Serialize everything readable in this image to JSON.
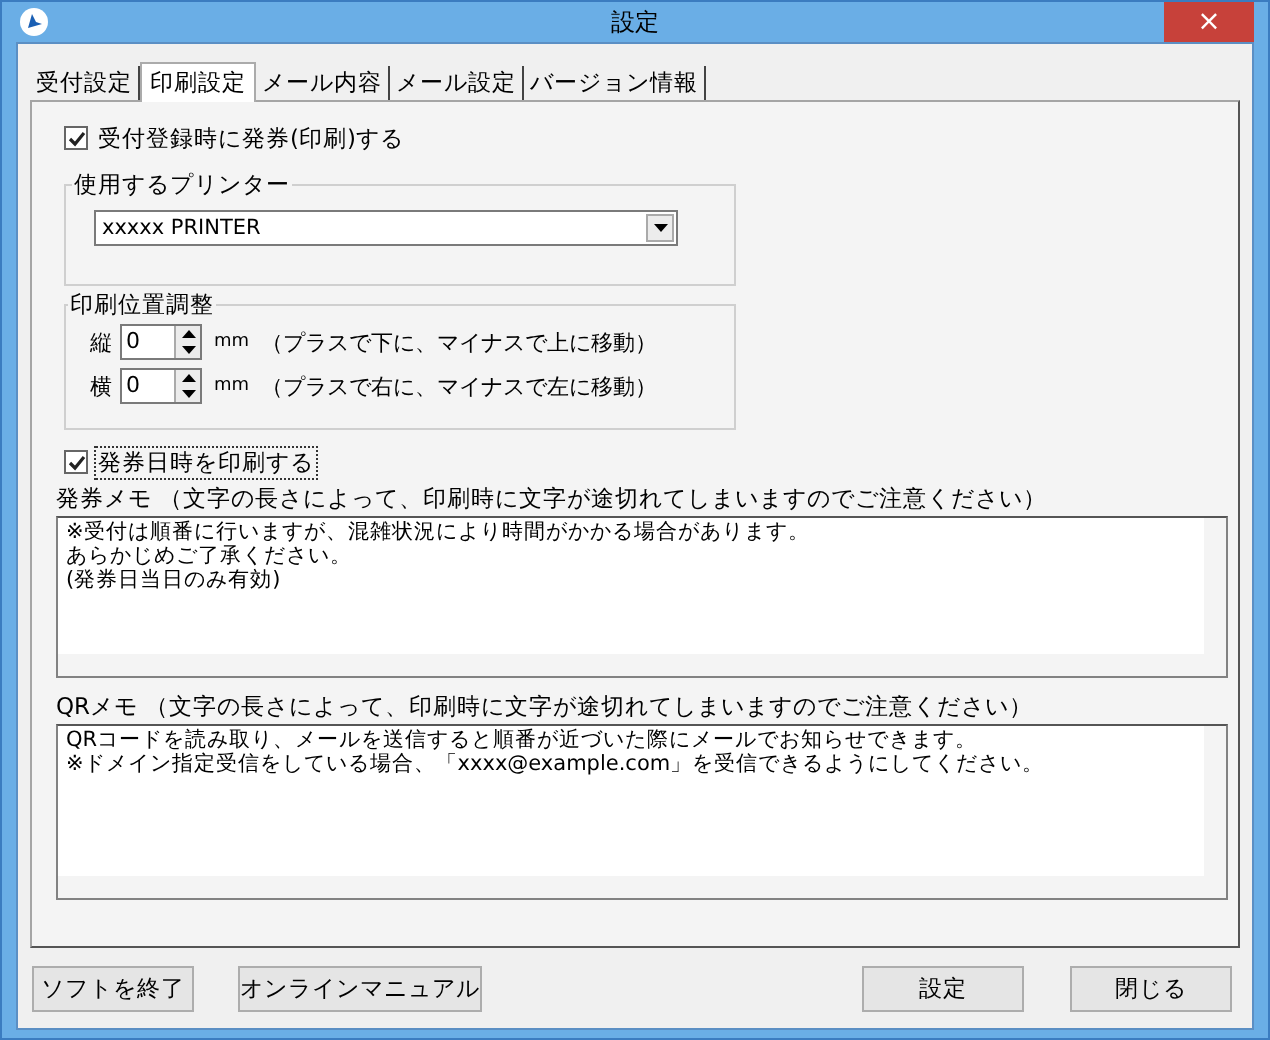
{
  "window": {
    "title": "設定",
    "close": "×"
  },
  "tabs": [
    {
      "label": "受付設定",
      "selected": false
    },
    {
      "label": "印刷設定",
      "selected": true
    },
    {
      "label": "メール内容",
      "selected": false
    },
    {
      "label": "メール設定",
      "selected": false
    },
    {
      "label": "バージョン情報",
      "selected": false
    }
  ],
  "print_on_register": {
    "label": "受付登録時に発券(印刷)する",
    "checked": true
  },
  "printer_group": {
    "title": "使用するプリンター",
    "printer": "xxxxx PRINTER"
  },
  "position_group": {
    "title": "印刷位置調整",
    "rows": [
      {
        "label": "縦",
        "value": "0",
        "unit": "mm",
        "hint": "（プラスで下に、マイナスで上に移動）"
      },
      {
        "label": "横",
        "value": "0",
        "unit": "mm",
        "hint": "（プラスで右に、マイナスで左に移動）"
      }
    ]
  },
  "print_datetime": {
    "label": "発券日時を印刷する",
    "checked": true
  },
  "memos": [
    {
      "label": "発券メモ （文字の長さによって、印刷時に文字が途切れてしまいますのでご注意ください）",
      "lines": [
        "※受付は順番に行いますが、混雑状況により時間がかかる場合があります。",
        "あらかじめご了承ください。",
        "(発券日当日のみ有効)"
      ]
    },
    {
      "label": "QRメモ （文字の長さによって、印刷時に文字が途切れてしまいますのでご注意ください）",
      "lines": [
        "QRコードを読み取り、メールを送信すると順番が近づいた際にメールでお知らせできます。",
        "※ドメイン指定受信をしている場合、「xxxx@example.com」を受信できるようにしてください。"
      ]
    }
  ],
  "buttons": [
    "ソフトを終了",
    "オンラインマニュアル",
    "設定",
    "閉じる"
  ]
}
